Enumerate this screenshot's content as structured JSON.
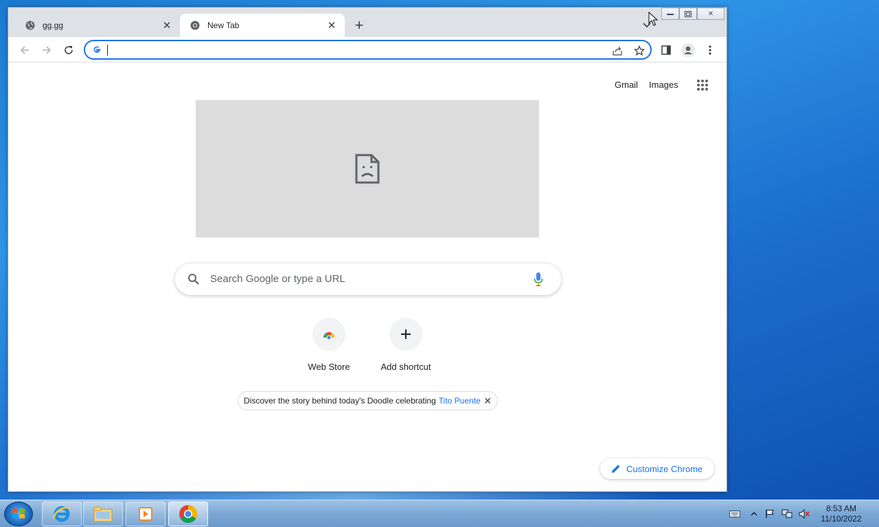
{
  "browser": {
    "tabs": [
      {
        "label": "gg.gg",
        "active": false
      },
      {
        "label": "New Tab",
        "active": true
      }
    ],
    "omnibox": {
      "value": "",
      "placeholder": ""
    }
  },
  "newtab": {
    "top_links": {
      "gmail": "Gmail",
      "images": "Images"
    },
    "search": {
      "placeholder": "Search Google or type a URL"
    },
    "shortcuts": [
      {
        "label": "Web Store"
      },
      {
        "label": "Add shortcut"
      }
    ],
    "promo": {
      "text": "Discover the story behind today's Doodle celebrating",
      "link": "Tito Puente"
    },
    "customize_label": "Customize Chrome"
  },
  "taskbar": {
    "clock": {
      "time": "8:53 AM",
      "date": "11/10/2022"
    }
  },
  "colors": {
    "accent": "#1a73e8",
    "tabstrip": "#dee1e6"
  }
}
